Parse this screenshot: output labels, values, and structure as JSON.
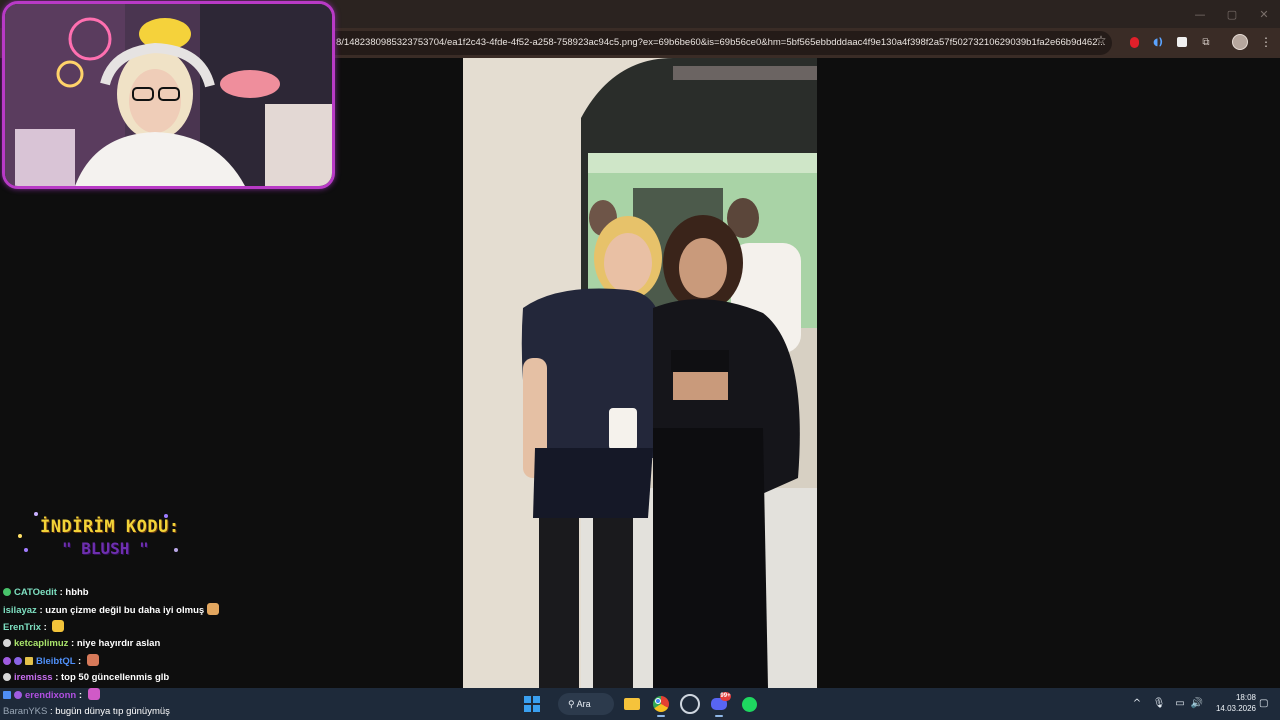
{
  "browser": {
    "url": "8/1482380985323753704/ea1f2c43-4fde-4f52-a258-758923ac94c5.png?ex=69b6be60&is=69b56ce0&hm=5bf565ebbdddaac4f9e130a4f398f2a57f50273210629039b1fa2e66b9d462...",
    "window_controls": {
      "minimize": "—",
      "maximize": "▢",
      "close": "✕"
    },
    "star_glyph": "☆",
    "extension_icons": [
      "record-icon",
      "sound-icon",
      "twitch-extension-icon",
      "puzzle-icon",
      "profile-avatar",
      "menu-icon"
    ],
    "sound_glyph": "◖)",
    "puzzle_glyph": "⧉",
    "menu_glyph": "⋮"
  },
  "stream_overlay": {
    "promo_title": "İNDİRİM KODU:",
    "promo_code": "\" BLUSH \"",
    "webcam_frame_color": "#b83ac6"
  },
  "chat": {
    "messages": [
      {
        "user": "CATOedit",
        "text": "hbhb",
        "user_color": "#7ee0c1",
        "badge_color": "#48c36a"
      },
      {
        "user": "isilayaz",
        "text": "uzun çizme değil bu daha iyi olmuş",
        "user_color": "#7ee0c1",
        "emote": true
      },
      {
        "user": "ErenTrix",
        "text": "",
        "user_color": "#7ee0c1",
        "emote": true
      },
      {
        "user": "ketcaplimuz",
        "text": "niye hayırdır aslan",
        "user_color": "#a8e36b",
        "badge_color": "#d8d8d8"
      },
      {
        "user": "BleibtQL",
        "text": "",
        "user_color": "#4f8ff7",
        "badge_color": "#a05ce0",
        "emote": true
      },
      {
        "user": "iremisss",
        "text": "top 50 güncellenmis glb",
        "user_color": "#c86ff0",
        "badge_color": "#d8d8d8"
      },
      {
        "user": "erendixonn",
        "text": "",
        "user_color": "#b04fe0",
        "badge_color": "#4f8ff7",
        "emote": true
      },
      {
        "user": "BaranYKS",
        "text": "bugün dünya tıp günüymüş",
        "user_color": "#9aa7b6"
      }
    ]
  },
  "taskbar": {
    "search_label": "Ara",
    "discord_badge": "99+",
    "clock_time": "18:08",
    "clock_date": "14.03.2026",
    "tray_chevron": "^",
    "tray_mic": "🎙",
    "tray_network": "▭",
    "tray_volume": "🔊",
    "tray_notification": "▢"
  }
}
